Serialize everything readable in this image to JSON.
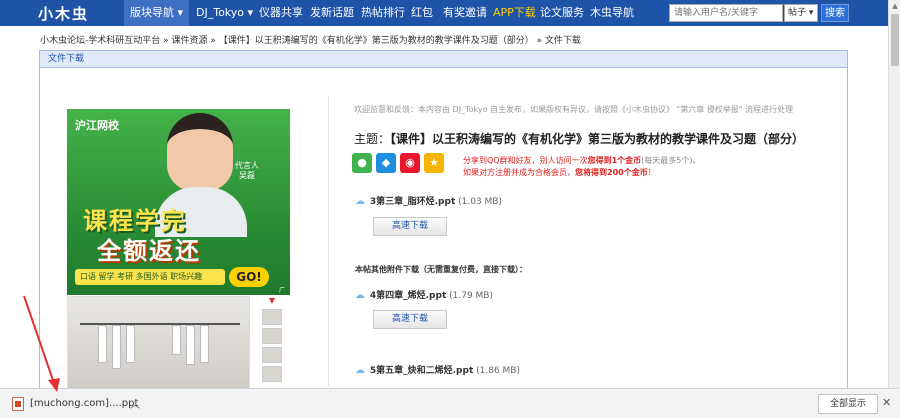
{
  "nav": {
    "logo": "小木虫",
    "items": [
      "版块导航 ▾",
      "DJ_Tokyo ▾",
      "仪器共享",
      "发新话题",
      "热帖排行",
      "红包",
      "有奖邀请",
      "APP下载",
      "论文服务",
      "木虫导航"
    ],
    "search_placeholder": "请输入用户名/关键字",
    "search_type": "帖子 ▾",
    "search_button": "搜索"
  },
  "breadcrumb": "小木虫论坛-学术科研互动平台 » 课件资源 » 【课件】以王积涛编写的《有机化学》第三版为教材的教学课件及习题（部分） » 文件下载",
  "panel": {
    "title": "文件下载"
  },
  "ad": {
    "logo": "沪江网校",
    "spokesperson": "代言人\n吴磊",
    "title1": "课程学完",
    "title2": "全额返还",
    "strip": "口语 留学 考研 多国外语 职场兴趣",
    "go": "GO!",
    "tag": "广告"
  },
  "notice": "欢迎监督和反馈：本内容由 DJ_Tokyo 自主发布，如果版权有异议，请按照《小木虫协议》 \"第六章 侵权举报\" 流程进行处理",
  "subject": {
    "label": "主题：",
    "title": "【课件】以王积涛编写的《有机化学》第三版为教材的教学课件及习题（部分）"
  },
  "reward": {
    "line1_a": "分享到QQ群和好友，别人访问一次",
    "line1_b": "您得到1个金币",
    "line1_c": "(每天最多5个)。",
    "line2_a": "如果对方注册并成为合格会员，",
    "line2_b": "您将得到200个金币",
    "line2_c": "！"
  },
  "files": [
    {
      "name": "3第三章_脂环烃.ppt",
      "size": "(1.03 MB)"
    },
    {
      "name": "4第四章_烯烃.ppt",
      "size": "(1.79 MB)"
    },
    {
      "name": "5第五章_炔和二烯烃.ppt",
      "size": "(1.86 MB)"
    }
  ],
  "download_button": "高速下载",
  "other_attachments": "本帖其他附件下载（无需重复付费，直接下载）：",
  "download_bar": {
    "filename": "[muchong.com]....ppt",
    "show_all": "全部显示"
  },
  "colors": {
    "nav_bg": "#1f53a8",
    "panel_header": "#dfe9f7",
    "reward_red": "#e02020"
  }
}
